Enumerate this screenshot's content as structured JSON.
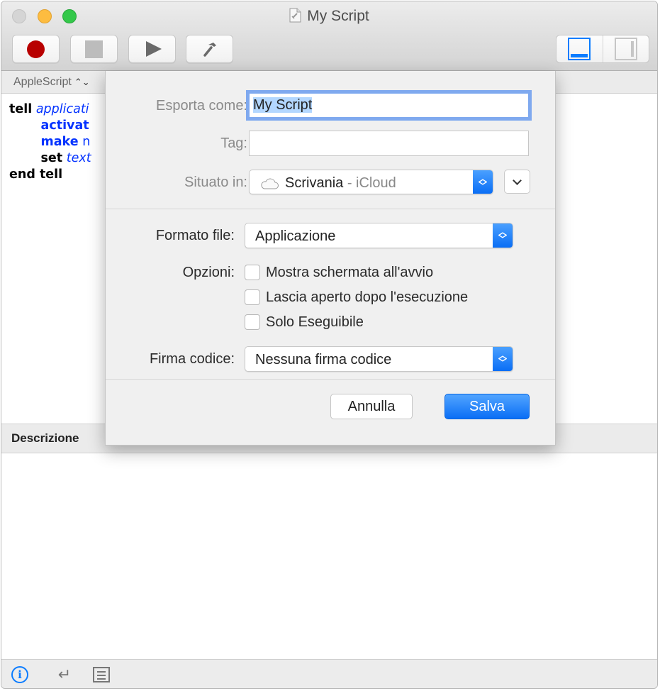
{
  "window": {
    "title": "My Script",
    "title_icon": "script-document-icon"
  },
  "toolbar": {
    "buttons": [
      {
        "name": "record",
        "icon": "record-icon"
      },
      {
        "name": "stop",
        "icon": "stop-icon"
      },
      {
        "name": "run",
        "icon": "play-icon"
      },
      {
        "name": "compile",
        "icon": "hammer-icon"
      }
    ],
    "view_toggle": {
      "options": [
        "bottom-pane-icon",
        "side-pane-icon"
      ],
      "selected": "bottom-pane-icon"
    }
  },
  "language_selector": {
    "value": "AppleScript",
    "arrows": "⌃⌄"
  },
  "editor": {
    "lines": [
      {
        "keyword": "tell",
        "rest": "applicati"
      },
      {
        "keyword": "activat",
        "rest": ""
      },
      {
        "keyword": "make",
        "rest": "n"
      },
      {
        "keyword": "set",
        "rest": "text"
      },
      {
        "keyword": "end tell",
        "rest": ""
      }
    ]
  },
  "description_pane": {
    "label": "Descrizione"
  },
  "bottom_bar": {
    "icons": [
      "info-icon",
      "return-icon",
      "list-icon"
    ]
  },
  "export_sheet": {
    "export_as_label": "Esporta come:",
    "export_as_value": "My Script",
    "tag_label": "Tag:",
    "tag_value": "",
    "location_label": "Situato in:",
    "location_value": "Scrivania",
    "location_suffix": " - iCloud",
    "file_format_label": "Formato file:",
    "file_format_value": "Applicazione",
    "options_label": "Opzioni:",
    "options": [
      {
        "label": "Mostra schermata all'avvio",
        "checked": false
      },
      {
        "label": "Lascia aperto dopo l'esecuzione",
        "checked": false
      },
      {
        "label": "Solo Eseguibile",
        "checked": false
      }
    ],
    "code_sign_label": "Firma codice:",
    "code_sign_value": "Nessuna firma codice",
    "cancel_label": "Annulla",
    "save_label": "Salva"
  },
  "colors": {
    "accent": "#0a7cff",
    "record": "#b80000",
    "keyword_blue": "#0433ff",
    "selection": "#b3d7ff"
  }
}
